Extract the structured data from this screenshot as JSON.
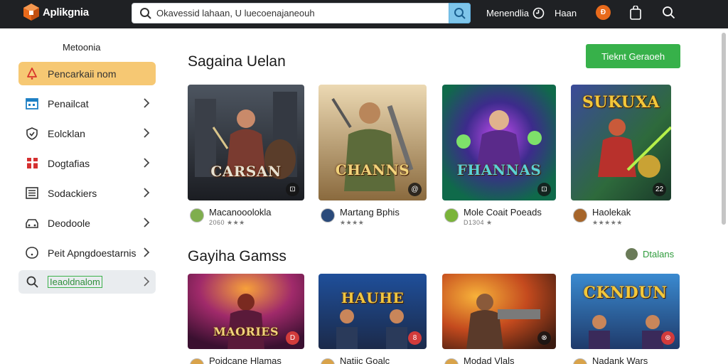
{
  "app": {
    "name": "Aplikgnia",
    "search_placeholder": "Okavessid lahaan, U luecoenajaneouh",
    "nav_link": "Menendlia",
    "nav_link2": "Haan",
    "badge_text": "Đ"
  },
  "sidebar": {
    "title": "Metoonia",
    "items": [
      {
        "label": "Pencarkaii nom",
        "icon": "bell-icon"
      },
      {
        "label": "Penailcat",
        "icon": "calendar-icon"
      },
      {
        "label": "Eolcklan",
        "icon": "shield-icon"
      },
      {
        "label": "Dogtafias",
        "icon": "gift-icon"
      },
      {
        "label": "Sodackiers",
        "icon": "list-icon"
      },
      {
        "label": "Deodoole",
        "icon": "car-icon"
      },
      {
        "label": "Peit Apngdoestarnis",
        "icon": "chat-icon"
      },
      {
        "label": "Ieaoldnalom",
        "icon": "search-icon"
      }
    ]
  },
  "main": {
    "section1_title": "Sagaina Uelan",
    "section1_button": "Tieknt Geraoeh",
    "section2_title": "Gayiha Gamss",
    "section2_link": "Dtalans",
    "games_row1": [
      {
        "name": "Macanooolokla",
        "sub": "2060 ★★★",
        "thumb_title": "CARSAN",
        "corner": "⊡"
      },
      {
        "name": "Martang Bphis",
        "sub": "★★★★",
        "thumb_title": "CHANNS",
        "corner": "@"
      },
      {
        "name": "Mole Coait Poeads",
        "sub": "D1304 ★",
        "thumb_title": "FHANNAS",
        "corner": "⊡"
      },
      {
        "name": "Haolekak",
        "sub": "★★★★★",
        "thumb_title": "SUKUXA",
        "corner": "22"
      }
    ],
    "games_row2": [
      {
        "name": "Poidcane Hlamas",
        "sub": "",
        "thumb_title": "MAORIES",
        "corner": "D"
      },
      {
        "name": "Natiic Goalc",
        "sub": "",
        "thumb_title": "HAUHE",
        "corner": "8"
      },
      {
        "name": "Modad Vlals",
        "sub": "",
        "thumb_title": "",
        "corner": "⊗"
      },
      {
        "name": "Nadank Wars",
        "sub": "",
        "thumb_title": "CKNDUN",
        "corner": "⊛"
      }
    ]
  },
  "colors": {
    "topbar": "#1f2124",
    "accent_green": "#37b14a",
    "active_item": "#f6c873",
    "logo_orange": "#e86a1b"
  }
}
